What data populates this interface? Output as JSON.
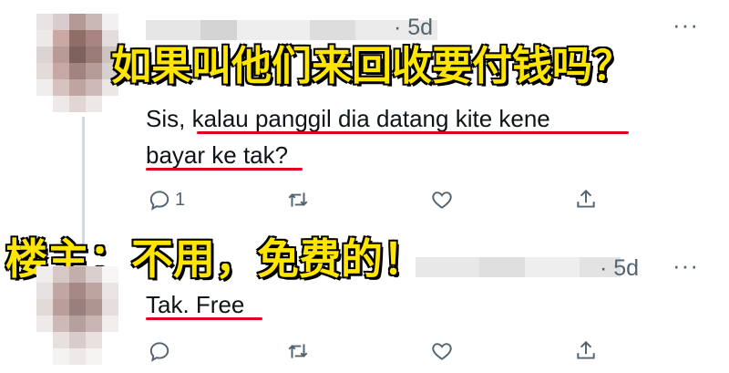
{
  "caption_question": "如果叫他们来回收要付钱吗？",
  "caption_answer": "楼主：不用，免费的！",
  "tweet1": {
    "time": "· 5d",
    "text_plain": "Sis,",
    "text_underlined_line1": "kalau panggil dia datang kite kene",
    "text_underlined_line2": "bayar ke tak",
    "text_after": "?",
    "reply_count": "1",
    "more": "···"
  },
  "tweet2": {
    "time": "· 5d",
    "text": "Tak. Free",
    "more": "···"
  },
  "icons": [
    "reply-icon",
    "retweet-icon",
    "like-icon",
    "share-icon"
  ],
  "colors": {
    "caption": "#ffe600",
    "underline": "#e0001b",
    "muted": "#536471"
  }
}
